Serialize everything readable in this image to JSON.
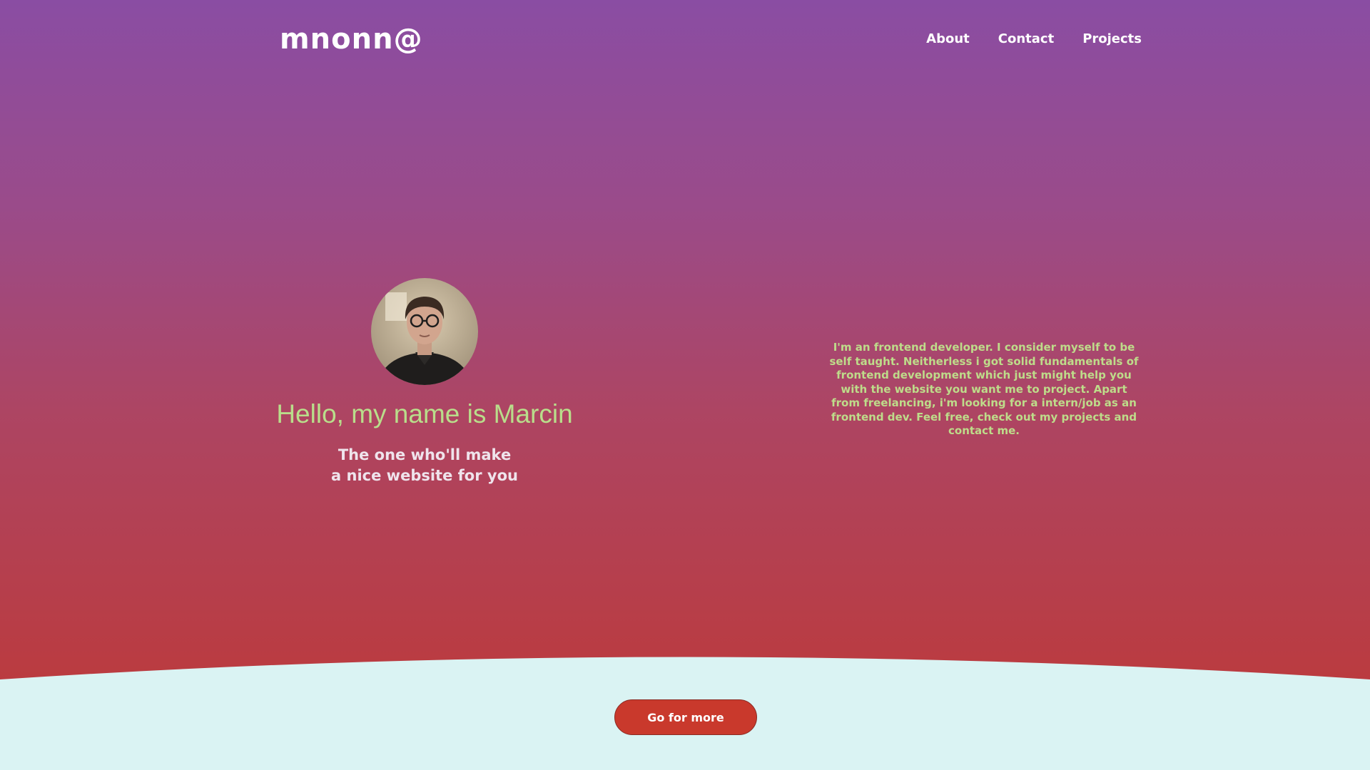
{
  "header": {
    "logo": "mnonn@",
    "nav": [
      {
        "label": "About"
      },
      {
        "label": "Contact"
      },
      {
        "label": "Projects"
      }
    ]
  },
  "hero": {
    "avatar": {
      "icon": "profile-photo"
    },
    "greeting": "Hello, my name is Marcin",
    "tagline_line1": "The one who'll make",
    "tagline_line2": "a nice website for you",
    "bio": "I'm an frontend developer. I consider myself to be self taught. Neitherless i got solid fundamentals of frontend development which just might help you with the website you want me to project. Apart from freelancing, i'm looking for a intern/job as an frontend dev. Feel free, check out my projects and contact me."
  },
  "footer": {
    "cta_label": "Go for more"
  },
  "colors": {
    "gradient_top": "#8a4da3",
    "gradient_bottom": "#bb3b3f",
    "greeting": "#b9de8b",
    "bio_text": "#bedc8a",
    "footer_bg": "#daf3f3",
    "cta_bg": "#c9392c"
  }
}
